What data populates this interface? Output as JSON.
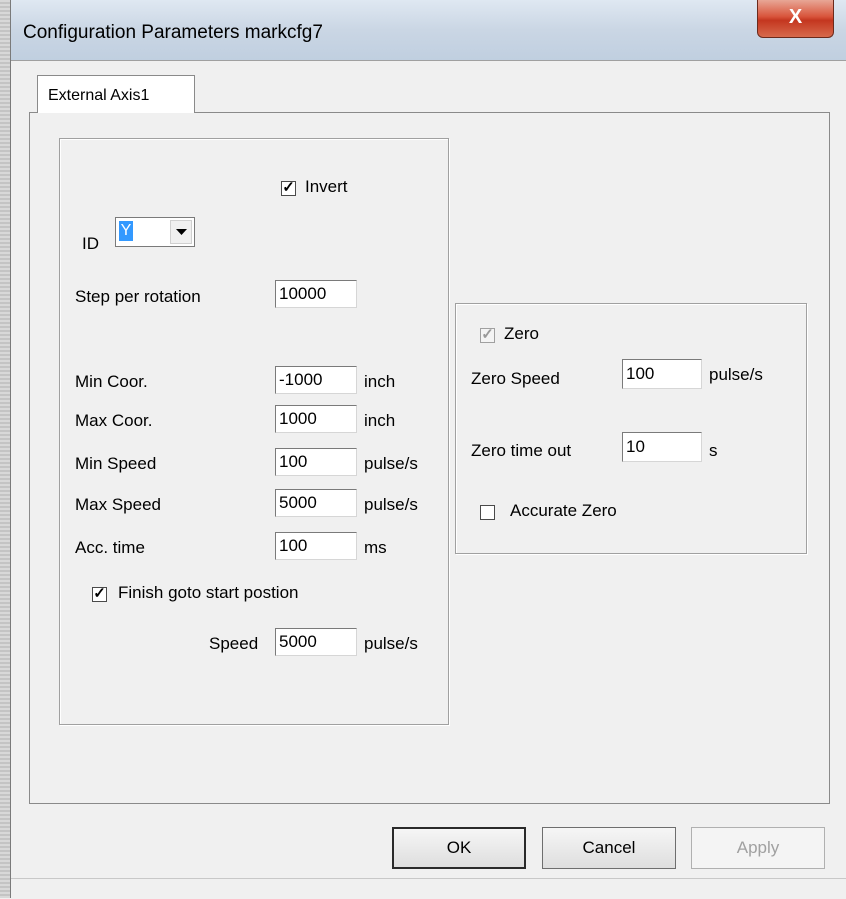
{
  "window": {
    "title": "Configuration Parameters markcfg7",
    "close_glyph": "X"
  },
  "tabs": [
    {
      "label": "External Axis1",
      "selected": true
    }
  ],
  "left_group": {
    "invert": {
      "label": "Invert",
      "checked": true
    },
    "id": {
      "label": "ID",
      "value": "Y"
    },
    "step_per_rotation": {
      "label": "Step per rotation",
      "value": "10000"
    },
    "min_coor": {
      "label": "Min Coor.",
      "value": "-1000",
      "unit": "inch"
    },
    "max_coor": {
      "label": "Max Coor.",
      "value": "1000",
      "unit": "inch"
    },
    "min_speed": {
      "label": "Min Speed",
      "value": "100",
      "unit": "pulse/s"
    },
    "max_speed": {
      "label": "Max Speed",
      "value": "5000",
      "unit": "pulse/s"
    },
    "acc_time": {
      "label": "Acc. time",
      "value": "100",
      "unit": "ms"
    },
    "finish_goto_start": {
      "label": "Finish goto start postion",
      "checked": true
    },
    "speed": {
      "label": "Speed",
      "value": "5000",
      "unit": "pulse/s"
    }
  },
  "right_group": {
    "zero": {
      "label": "Zero",
      "checked": true,
      "disabled": true
    },
    "zero_speed": {
      "label": "Zero Speed",
      "value": "100",
      "unit": "pulse/s"
    },
    "zero_time_out": {
      "label": "Zero time out",
      "value": "10",
      "unit": "s"
    },
    "accurate_zero": {
      "label": "Accurate Zero",
      "checked": false
    }
  },
  "buttons": {
    "ok": "OK",
    "cancel": "Cancel",
    "apply": "Apply"
  }
}
